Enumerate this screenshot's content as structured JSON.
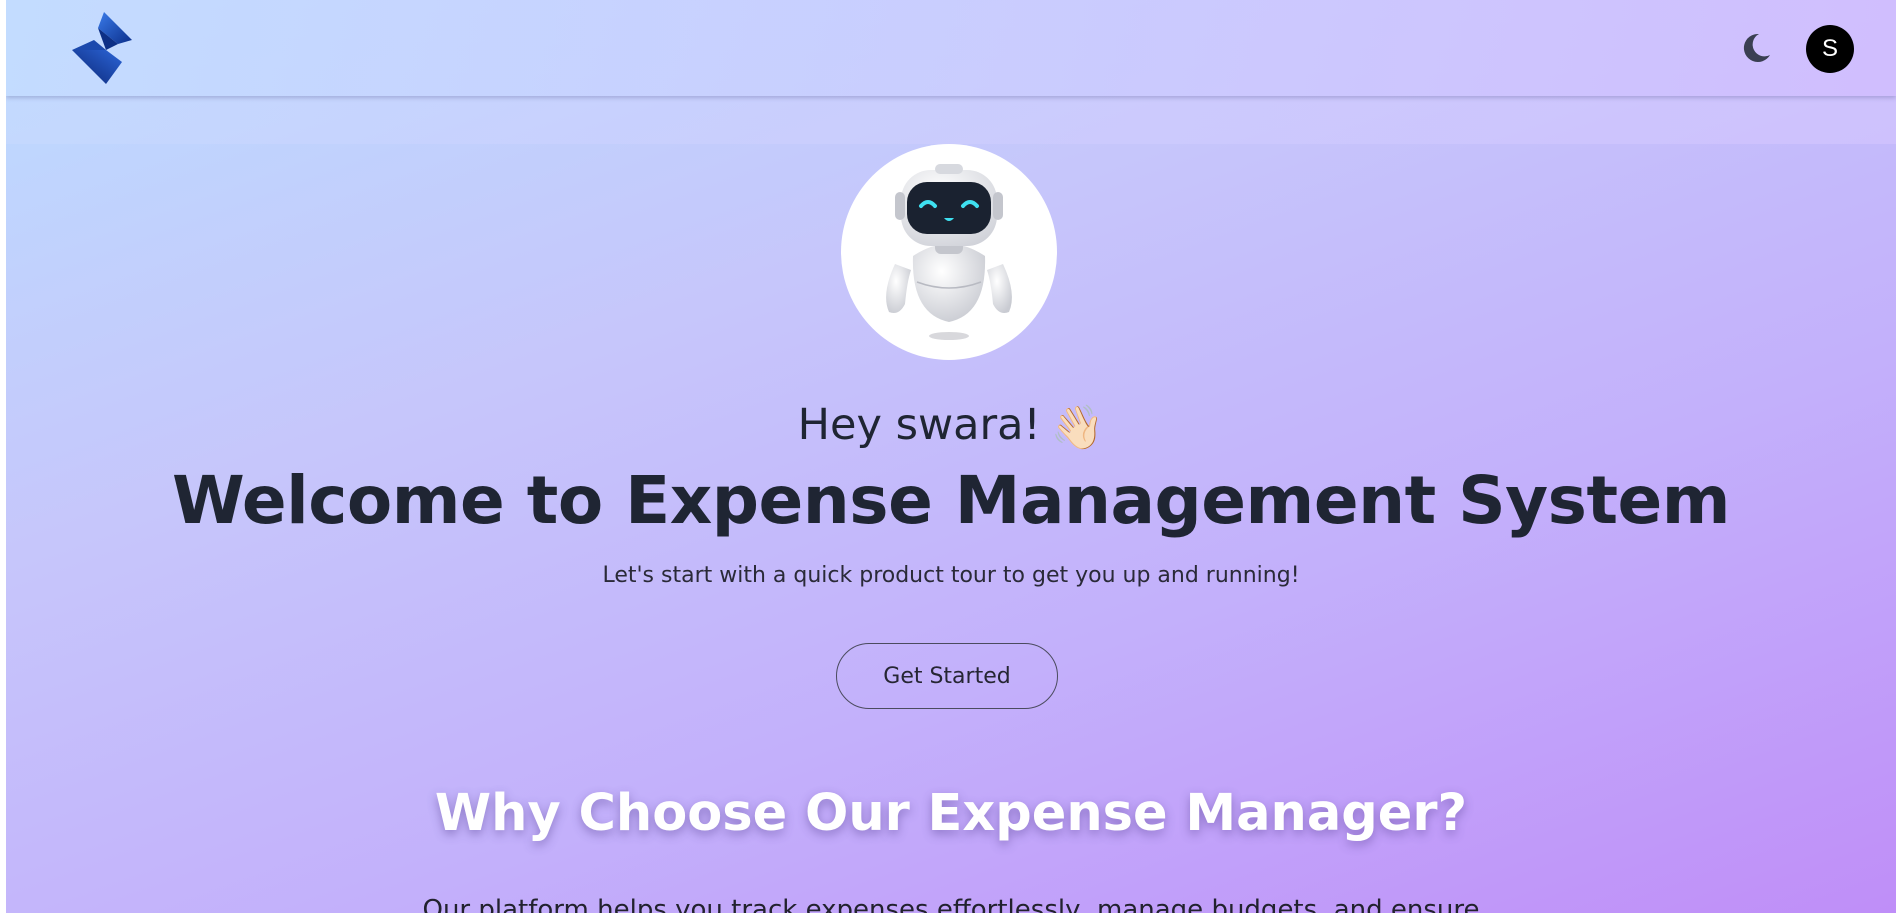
{
  "header": {
    "logo_icon": "brand-s-logo-icon",
    "theme_toggle_icon": "moon-icon",
    "avatar_initial": "S"
  },
  "hero": {
    "image_icon": "robot-mascot",
    "greeting": "Hey swara!",
    "greeting_emoji": "👋🏻",
    "headline": "Welcome to Expense Management System",
    "subtitle": "Let's start with a quick product tour to get you up and running!",
    "cta_label": "Get Started"
  },
  "features": {
    "title": "Why Choose Our Expense Manager?",
    "description": "Our platform helps you track expenses effortlessly, manage budgets, and ensure"
  },
  "colors": {
    "text_dark": "#1f2533",
    "avatar_bg": "#000000",
    "logo_blue": "#1e4fb8",
    "robot_visor": "#1a2230",
    "robot_eyes": "#3fe0f0"
  }
}
